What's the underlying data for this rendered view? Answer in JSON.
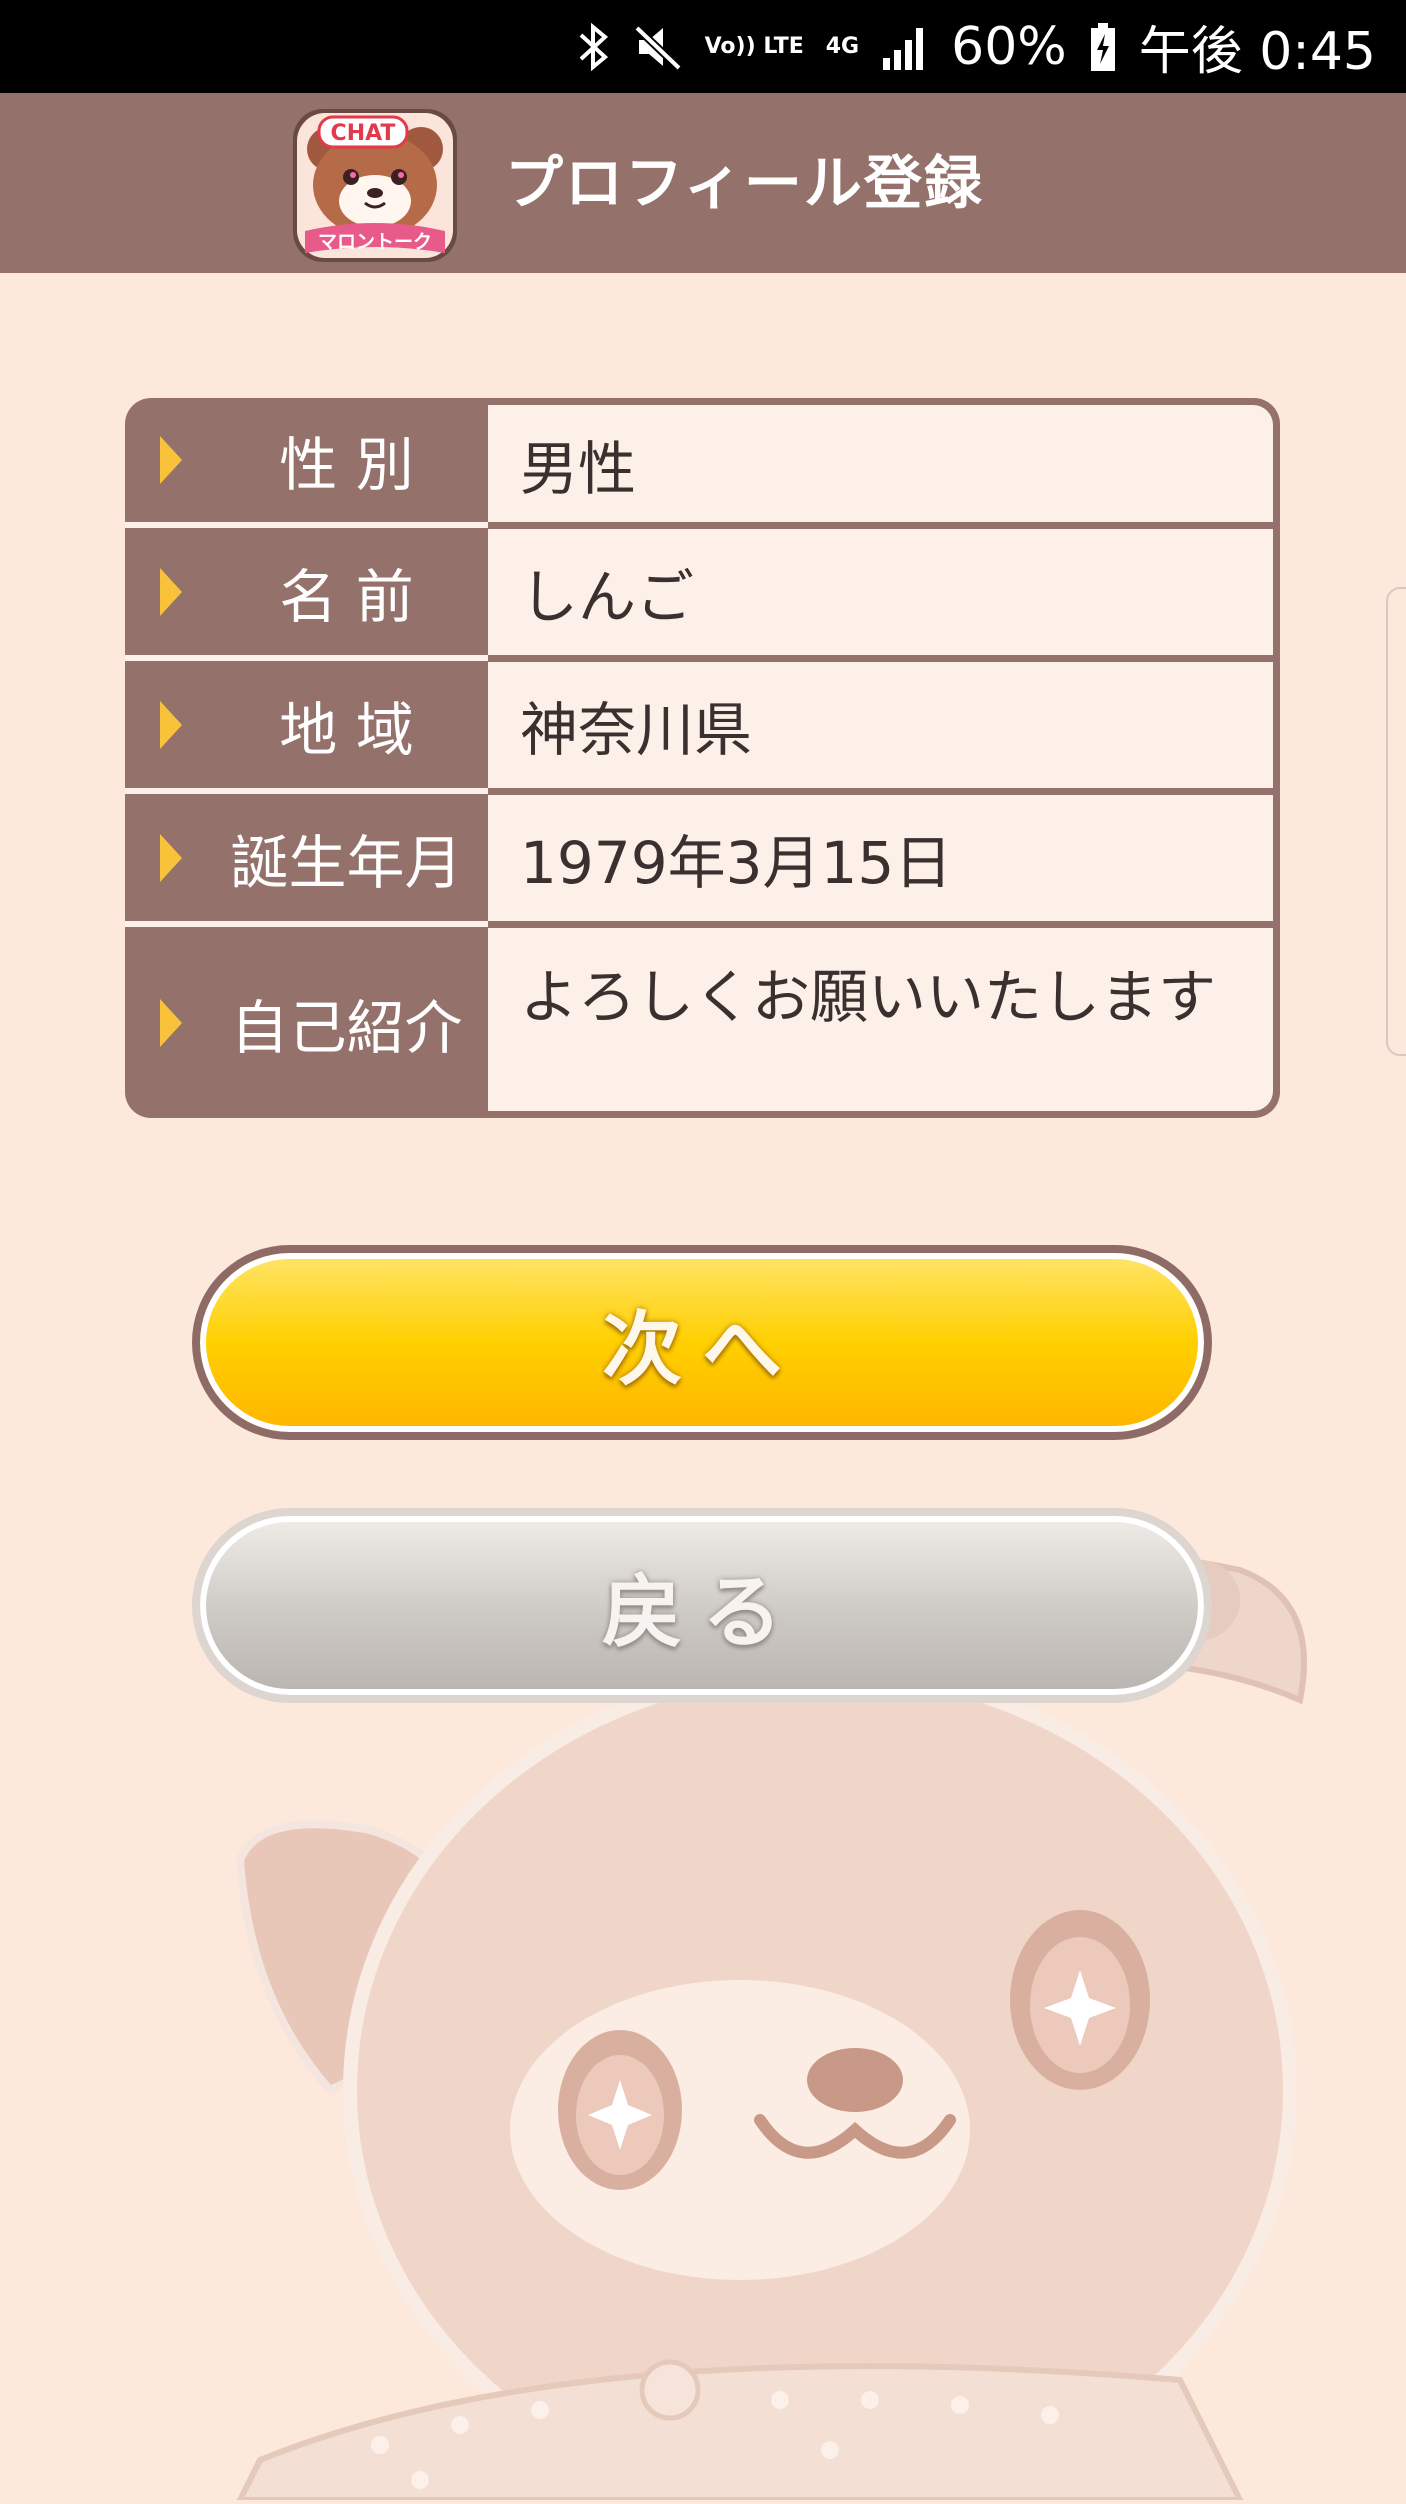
{
  "status_bar": {
    "volte": "Vo)) LTE",
    "network": "4G",
    "battery": "60%",
    "time": "午後 0:45",
    "icons": [
      "bluetooth-icon",
      "mute-icon",
      "volte-icon",
      "4g-icon",
      "signal-icon",
      "battery-charging-icon"
    ]
  },
  "app_bar": {
    "logo_text_top": "CHAT",
    "logo_text_bottom": "マロントーク",
    "title": "プロフィール登録"
  },
  "form": {
    "rows": [
      {
        "label": "性 別",
        "value": "男性"
      },
      {
        "label": "名 前",
        "value": "しんご"
      },
      {
        "label": "地 域",
        "value": "神奈川県"
      },
      {
        "label": "誕生年月",
        "value": "1979年3月15日"
      },
      {
        "label": "自己紹介",
        "value": "よろしくお願いいたします"
      }
    ]
  },
  "buttons": {
    "next": "次へ",
    "back": "戻る"
  },
  "colors": {
    "header": "#94726b",
    "background": "#fde9dc",
    "accent_yellow": "#ffd000",
    "arrow": "#f8c33a"
  }
}
